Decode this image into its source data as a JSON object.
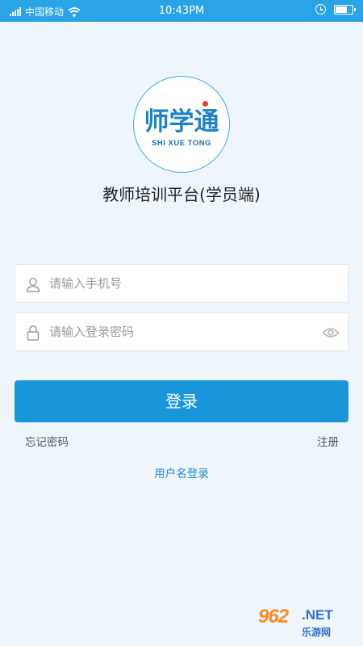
{
  "status_bar": {
    "carrier": "中国移动",
    "time": "10:43PM",
    "battery_level": 0.75,
    "icons": [
      "signal-icon",
      "wifi-icon",
      "clock-icon",
      "battery-icon"
    ]
  },
  "logo": {
    "name_cn": "师学通",
    "name_en": "SHI XUE TONG"
  },
  "app_title": "教师培训平台(学员端)",
  "form": {
    "phone_placeholder": "请输入手机号",
    "phone_value": "",
    "password_placeholder": "请输入登录密码",
    "password_value": "",
    "login_label": "登录"
  },
  "links": {
    "forgot_password": "忘记密码",
    "register": "注册",
    "username_login": "用户名登录"
  },
  "watermark": {
    "number": "962",
    "net": ".NET",
    "cn": "乐游网"
  },
  "colors": {
    "status_bar": "#2aa4e6",
    "background": "#eef6fc",
    "primary_button": "#1996d9",
    "link": "#1e8bd0"
  }
}
